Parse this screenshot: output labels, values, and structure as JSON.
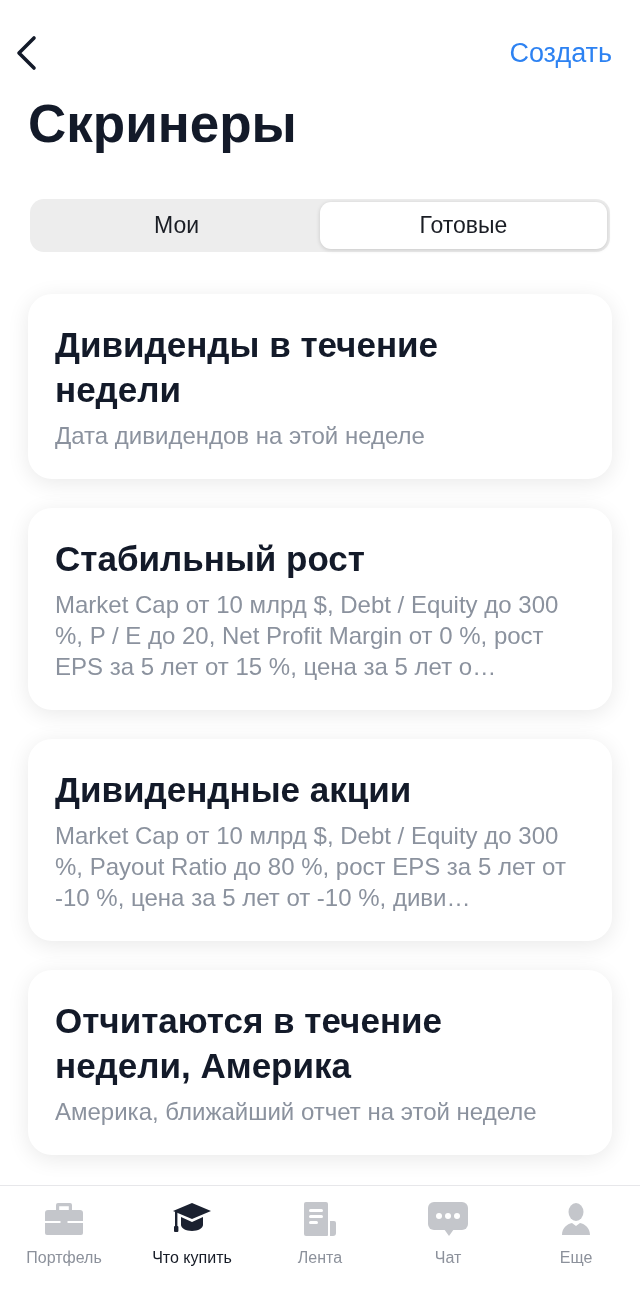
{
  "header": {
    "action": "Создать"
  },
  "title": "Скринеры",
  "segments": [
    {
      "label": "Мои",
      "selected": false
    },
    {
      "label": "Готовые",
      "selected": true
    }
  ],
  "screeners": [
    {
      "title": "Дивиденды в течение недели",
      "description": "Дата дивидендов на этой неделе"
    },
    {
      "title": "Стабильный рост",
      "description": "Market Cap от 10 млрд $, Debt / Equity до 300 %, P / E до 20, Net Profit Margin от 0 %, рост EPS за 5 лет от 15 %, цена за 5 лет о…"
    },
    {
      "title": "Дивидендные акции",
      "description": "Market Cap от 10 млрд $, Debt / Equity до 300 %, Payout Ratio до 80 %, рост EPS за 5 лет от -10 %, цена за 5 лет от -10 %, диви…"
    },
    {
      "title": "Отчитаются в течение недели, Америка",
      "description": "Америка, ближайший отчет на этой неделе"
    }
  ],
  "tab_bar": [
    {
      "label": "Портфель",
      "selected": false
    },
    {
      "label": "Что купить",
      "selected": true
    },
    {
      "label": "Лента",
      "selected": false
    },
    {
      "label": "Чат",
      "selected": false
    },
    {
      "label": "Еще",
      "selected": false
    }
  ]
}
